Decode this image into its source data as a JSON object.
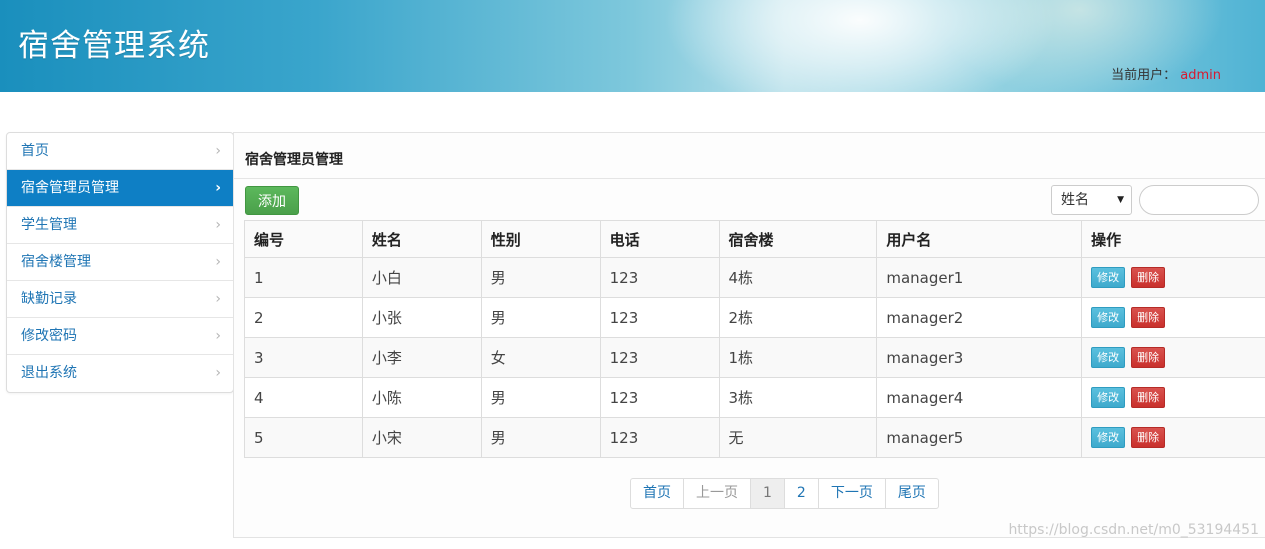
{
  "header": {
    "title": "宿舍管理系统",
    "current_user_label": "当前用户：",
    "current_user": "admin",
    "user_color": "#d9192f"
  },
  "sidebar": {
    "items": [
      {
        "label": "首页",
        "active": false
      },
      {
        "label": "宿舍管理员管理",
        "active": true
      },
      {
        "label": "学生管理",
        "active": false
      },
      {
        "label": "宿舍楼管理",
        "active": false
      },
      {
        "label": "缺勤记录",
        "active": false
      },
      {
        "label": "修改密码",
        "active": false
      },
      {
        "label": "退出系统",
        "active": false
      }
    ],
    "chevron": "›",
    "active_color": "#0e7fc5"
  },
  "main": {
    "page_title": "宿舍管理员管理",
    "add_button": "添加",
    "search": {
      "field_selected": "姓名",
      "query_value": "",
      "query_placeholder": ""
    },
    "table": {
      "headers": [
        "编号",
        "姓名",
        "性别",
        "电话",
        "宿舍楼",
        "用户名",
        "操作"
      ],
      "rows": [
        [
          "1",
          "小白",
          "男",
          "123",
          "4栋",
          "manager1"
        ],
        [
          "2",
          "小张",
          "男",
          "123",
          "2栋",
          "manager2"
        ],
        [
          "3",
          "小李",
          "女",
          "123",
          "1栋",
          "manager3"
        ],
        [
          "4",
          "小陈",
          "男",
          "123",
          "3栋",
          "manager4"
        ],
        [
          "5",
          "小宋",
          "男",
          "123",
          "无",
          "manager5"
        ]
      ],
      "edit_label": "修改",
      "delete_label": "删除"
    },
    "pagination": {
      "first": "首页",
      "prev": "上一页",
      "pages": [
        "1",
        "2"
      ],
      "current_page": "1",
      "next": "下一页",
      "last": "尾页"
    }
  },
  "watermark": "https://blog.csdn.net/m0_53194451"
}
